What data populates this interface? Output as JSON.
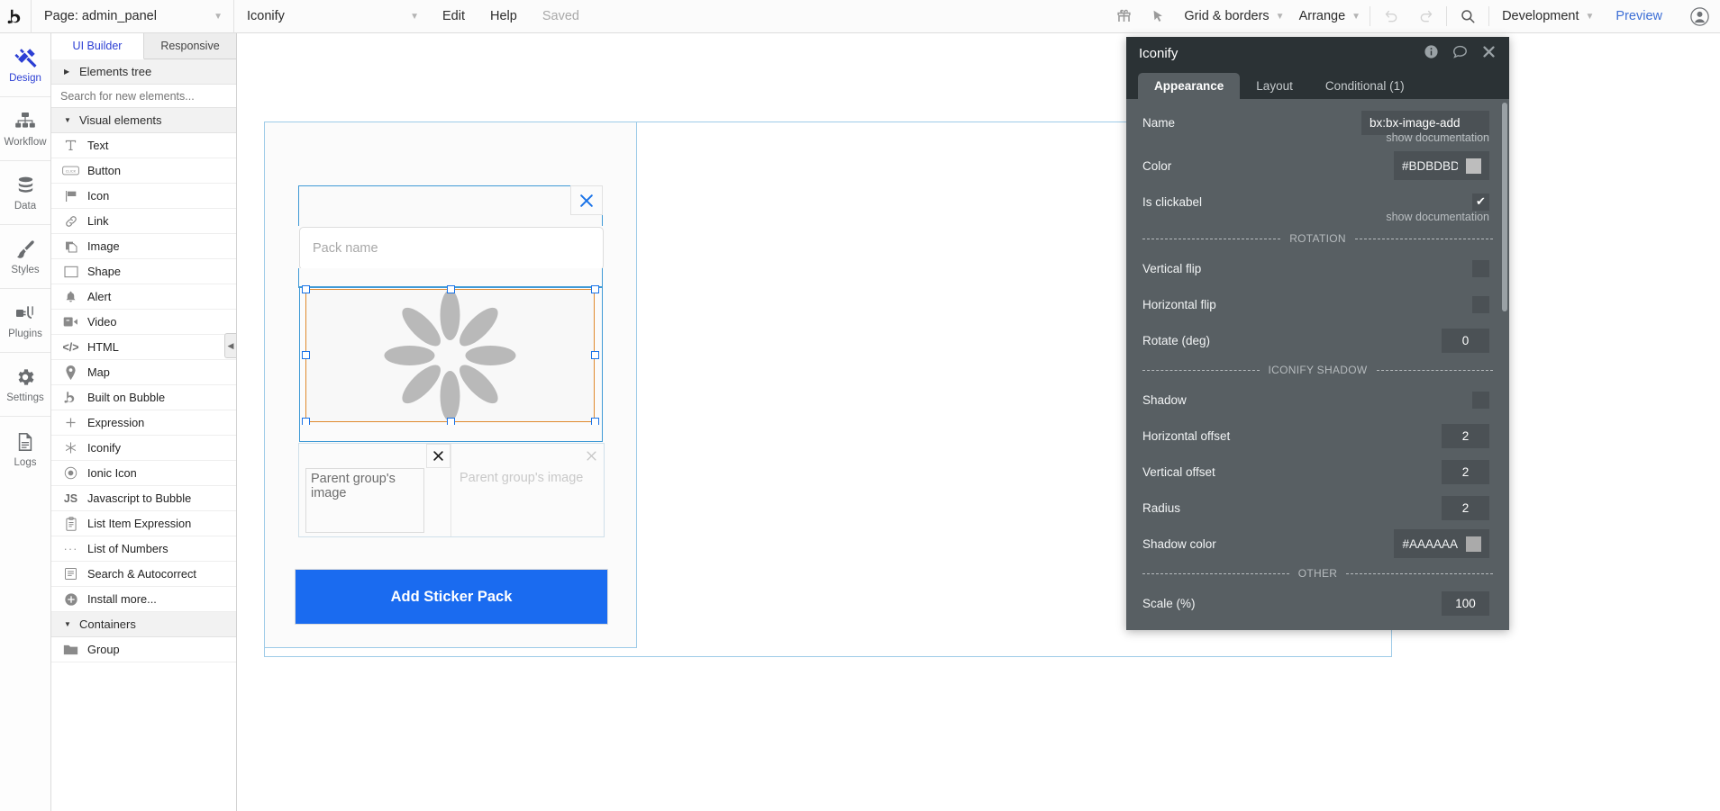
{
  "topbar": {
    "logo_icon": "bubble-logo-icon",
    "page_selector": "Page: admin_panel",
    "element_selector": "Iconify",
    "edit": "Edit",
    "help": "Help",
    "saved": "Saved",
    "gift_icon": "gift-icon",
    "cursor_icon": "cursor-arrow-icon",
    "grid_borders": "Grid & borders",
    "arrange": "Arrange",
    "undo_icon": "undo-icon",
    "redo_icon": "redo-icon",
    "search_icon": "search-icon",
    "environment": "Development",
    "preview": "Preview",
    "avatar_icon": "user-avatar-icon"
  },
  "rail": {
    "items": [
      {
        "label": "Design",
        "icon": "design-icon",
        "active": true
      },
      {
        "label": "Workflow",
        "icon": "workflow-icon",
        "active": false
      },
      {
        "label": "Data",
        "icon": "database-icon",
        "active": false
      },
      {
        "label": "Styles",
        "icon": "paintbrush-icon",
        "active": false
      },
      {
        "label": "Plugins",
        "icon": "plug-icon",
        "active": false
      },
      {
        "label": "Settings",
        "icon": "gear-icon",
        "active": false
      },
      {
        "label": "Logs",
        "icon": "document-icon",
        "active": false
      }
    ]
  },
  "elements_panel": {
    "tabs": [
      {
        "label": "UI Builder",
        "active": true
      },
      {
        "label": "Responsive",
        "active": false
      }
    ],
    "elements_tree": "Elements tree",
    "search_placeholder": "Search for new elements...",
    "search_value": "",
    "sections": [
      {
        "title": "Visual elements",
        "items": [
          {
            "label": "Text",
            "icon": "text-icon"
          },
          {
            "label": "Button",
            "icon": "button-icon"
          },
          {
            "label": "Icon",
            "icon": "flag-icon"
          },
          {
            "label": "Link",
            "icon": "link-icon"
          },
          {
            "label": "Image",
            "icon": "image-icon"
          },
          {
            "label": "Shape",
            "icon": "shape-icon"
          },
          {
            "label": "Alert",
            "icon": "bell-icon"
          },
          {
            "label": "Video",
            "icon": "video-icon"
          },
          {
            "label": "HTML",
            "icon": "code-icon"
          },
          {
            "label": "Map",
            "icon": "map-pin-icon"
          },
          {
            "label": "Built on Bubble",
            "icon": "bubble-logo-icon"
          },
          {
            "label": "Expression",
            "icon": "plus-icon"
          },
          {
            "label": "Iconify",
            "icon": "iconify-asterisk-icon"
          },
          {
            "label": "Ionic Icon",
            "icon": "ionic-circle-icon"
          },
          {
            "label": "Javascript to Bubble",
            "icon": "js-icon"
          },
          {
            "label": "List Item Expression",
            "icon": "clipboard-icon"
          },
          {
            "label": "List of Numbers",
            "icon": "ellipsis-icon"
          },
          {
            "label": "Search & Autocorrect",
            "icon": "list-icon"
          },
          {
            "label": "Install more...",
            "icon": "plus-circle-icon"
          }
        ]
      },
      {
        "title": "Containers",
        "items": [
          {
            "label": "Group",
            "icon": "folder-icon"
          }
        ]
      }
    ],
    "collapse_handle_icon": "chevron-left-icon"
  },
  "canvas": {
    "popup_close_icon": "close-icon",
    "pack_name_placeholder": "Pack name",
    "pack_name_value": "",
    "loading_icon": "spinner-flower-icon",
    "image_cells": [
      {
        "label": "Parent group's image",
        "close_icon": "close-icon",
        "ghost": false
      },
      {
        "label": "Parent group's image",
        "close_icon": "close-icon",
        "ghost": true
      }
    ],
    "cta_label": "Add Sticker Pack",
    "cta_color": "#1a6bf0"
  },
  "properties": {
    "title": "Iconify",
    "info_icon": "info-icon",
    "comment_icon": "comment-icon",
    "close_icon": "close-icon",
    "tabs": [
      {
        "label": "Appearance",
        "active": true
      },
      {
        "label": "Layout",
        "active": false
      },
      {
        "label": "Conditional (1)",
        "active": false
      }
    ],
    "fields": [
      {
        "kind": "text",
        "label": "Name",
        "value": "bx:bx-image-add",
        "hint": "show documentation"
      },
      {
        "kind": "color",
        "label": "Color",
        "value": "#BDBDBD",
        "swatch": "#bdbdbd"
      },
      {
        "kind": "check",
        "label": "Is clickabel",
        "checked": true,
        "check_glyph": "✔",
        "hint": "show documentation"
      },
      {
        "kind": "divider",
        "label": "ROTATION"
      },
      {
        "kind": "check",
        "label": "Vertical flip",
        "checked": false
      },
      {
        "kind": "check",
        "label": "Horizontal flip",
        "checked": false
      },
      {
        "kind": "num",
        "label": "Rotate (deg)",
        "value": "0"
      },
      {
        "kind": "divider",
        "label": "ICONIFY SHADOW"
      },
      {
        "kind": "check",
        "label": "Shadow",
        "checked": false
      },
      {
        "kind": "num",
        "label": "Horizontal offset",
        "value": "2"
      },
      {
        "kind": "num",
        "label": "Vertical offset",
        "value": "2"
      },
      {
        "kind": "num",
        "label": "Radius",
        "value": "2"
      },
      {
        "kind": "color",
        "label": "Shadow color",
        "value": "#AAAAAA",
        "swatch": "#aaaaaa"
      },
      {
        "kind": "divider",
        "label": "OTHER"
      },
      {
        "kind": "num",
        "label": "Scale (%)",
        "value": "100"
      }
    ]
  }
}
